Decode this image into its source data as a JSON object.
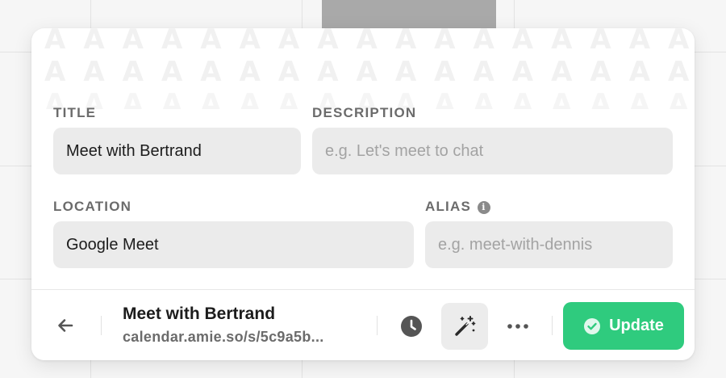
{
  "form": {
    "title": {
      "label": "TITLE",
      "value": "Meet with Bertrand"
    },
    "description": {
      "label": "DESCRIPTION",
      "placeholder": "e.g. Let's meet to chat"
    },
    "location": {
      "label": "LOCATION",
      "value": "Google Meet"
    },
    "alias": {
      "label": "ALIAS",
      "placeholder": "e.g. meet-with-dennis",
      "info_icon": "i"
    }
  },
  "footer": {
    "event_title": "Meet with Bertrand",
    "event_url": "calendar.amie.so/s/5c9a5b...",
    "update_label": "Update",
    "more_glyph": "•••"
  },
  "pattern": {
    "glyph": "A"
  },
  "colors": {
    "accent_green": "#2fcb7e",
    "field_bg": "#ebebeb",
    "label_gray": "#6b6b6b"
  },
  "icons": [
    "back-arrow-icon",
    "clock-icon",
    "magic-wand-icon",
    "more-icon",
    "check-circle-icon",
    "info-icon"
  ]
}
